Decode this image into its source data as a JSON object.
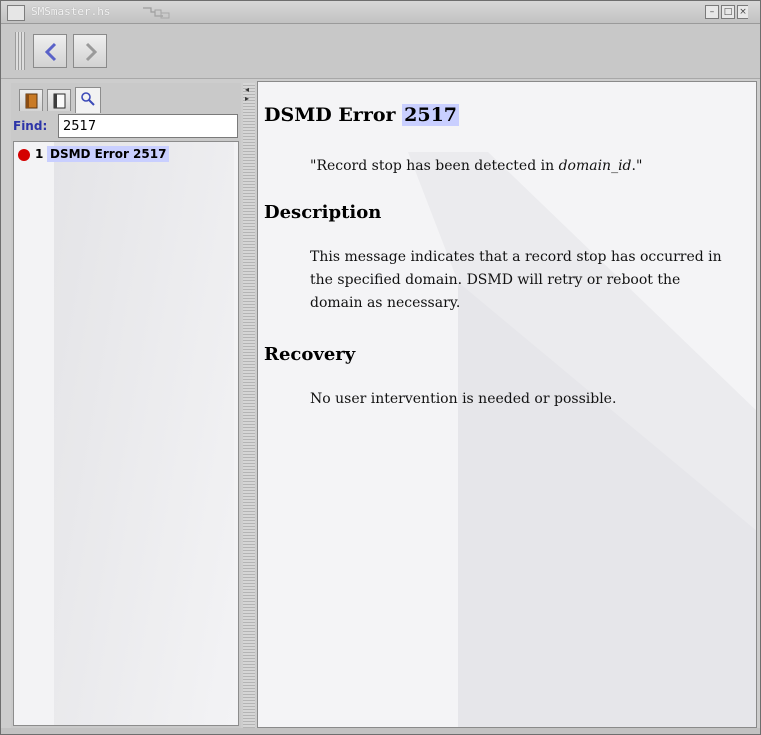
{
  "window": {
    "title": "SMSmaster.hs",
    "controls": {
      "minimize": "–",
      "maximize": "□",
      "close": "×"
    }
  },
  "toolbar": {
    "back_icon": "chevron-left-icon",
    "forward_icon": "chevron-right-icon"
  },
  "sidebar": {
    "tabs": [
      {
        "name": "contents-tab",
        "icon": "book-icon"
      },
      {
        "name": "index-tab",
        "icon": "page-icon"
      },
      {
        "name": "search-tab",
        "icon": "magnifier-icon"
      }
    ],
    "find_label": "Find:",
    "find_value": "2517",
    "results": [
      {
        "rank": "1",
        "title": "DSMD Error 2517",
        "status_color": "#d40000"
      }
    ]
  },
  "content": {
    "title_prefix": "DSMD Error ",
    "title_number": "2517",
    "quote_start": "\"Record stop has been detected in ",
    "quote_italic": "domain_id",
    "quote_end": ".\"",
    "sections": [
      {
        "heading": "Description",
        "body": "This message indicates that a record stop has occurred in the specified domain. DSMD will retry or reboot the domain as necessary."
      },
      {
        "heading": "Recovery",
        "body": "No user intervention is needed or possible."
      }
    ],
    "highlight_color": "#c9cfff"
  }
}
